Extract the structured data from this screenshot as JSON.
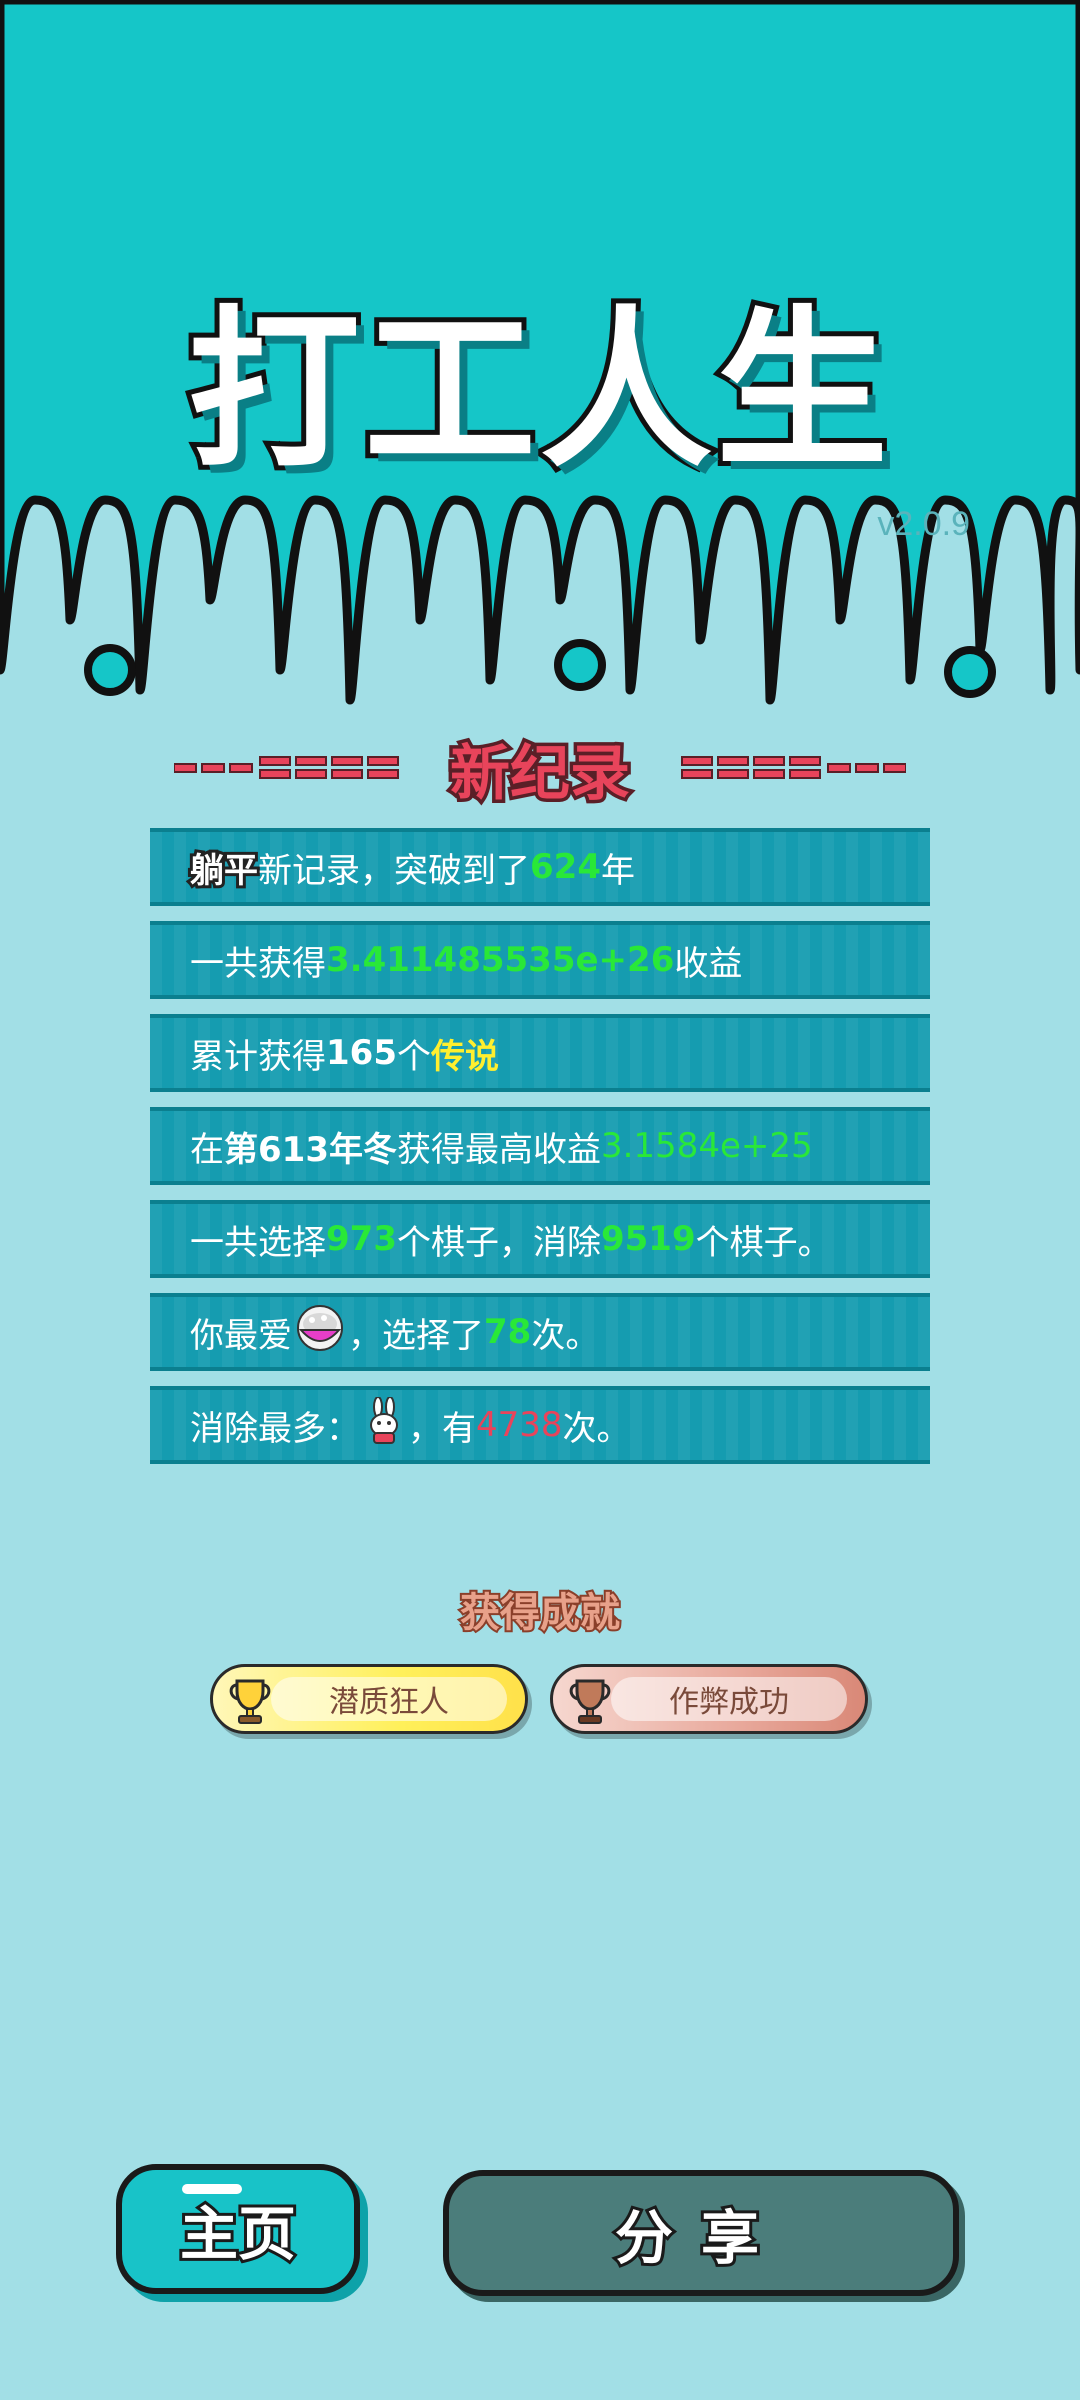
{
  "header": {
    "game_title": "打工人生",
    "version": "v2.0.9"
  },
  "section_heading": "新纪录",
  "records": [
    {
      "parts": [
        {
          "text": "躺平",
          "style": "tag-stroke"
        },
        {
          "text": "新记录，突破到了"
        },
        {
          "text": "624",
          "style": "hl-green"
        },
        {
          "text": "年"
        }
      ]
    },
    {
      "parts": [
        {
          "text": "一共获得"
        },
        {
          "text": "3.411485535e+26",
          "style": "hl-green"
        },
        {
          "text": "收益"
        }
      ]
    },
    {
      "parts": [
        {
          "text": "累计获得"
        },
        {
          "text": "165",
          "style": "hl-white"
        },
        {
          "text": "个"
        },
        {
          "text": "传说",
          "style": "hl-yellow"
        }
      ]
    },
    {
      "parts": [
        {
          "text": "在 "
        },
        {
          "text": "第613年冬",
          "style": "hl-white"
        },
        {
          "text": " 获得最高收益"
        },
        {
          "text": "3.1584e+25",
          "style": "hl-green-light"
        }
      ]
    },
    {
      "parts": [
        {
          "text": "一共选择"
        },
        {
          "text": "973",
          "style": "hl-green"
        },
        {
          "text": "个棋子，消除"
        },
        {
          "text": "9519",
          "style": "hl-green"
        },
        {
          "text": "个棋子。"
        }
      ]
    },
    {
      "parts": [
        {
          "text": "你最爱"
        },
        {
          "icon": "rice-bowl-icon"
        },
        {
          "text": "，选择了"
        },
        {
          "text": "78",
          "style": "hl-green"
        },
        {
          "text": "次。"
        }
      ]
    },
    {
      "parts": [
        {
          "text": "消除最多："
        },
        {
          "icon": "rabbit-icon"
        },
        {
          "text": "，有"
        },
        {
          "text": "4738",
          "style": "hl-red"
        },
        {
          "text": "次。"
        }
      ]
    }
  ],
  "achievements": {
    "title": "获得成就",
    "badges": [
      {
        "label": "潜质狂人",
        "tier": "gold",
        "icon": "gold-trophy-icon"
      },
      {
        "label": "作弊成功",
        "tier": "bronze",
        "icon": "bronze-trophy-icon"
      }
    ]
  },
  "buttons": {
    "home_label": "主页",
    "share_label": "分享"
  },
  "colors": {
    "top_background": "#15c6c8",
    "page_background": "#a2dfe6",
    "record_row": "#159cb0",
    "highlight_green": "#29e838",
    "highlight_yellow": "#ffef2e",
    "highlight_red": "#e8445b"
  }
}
